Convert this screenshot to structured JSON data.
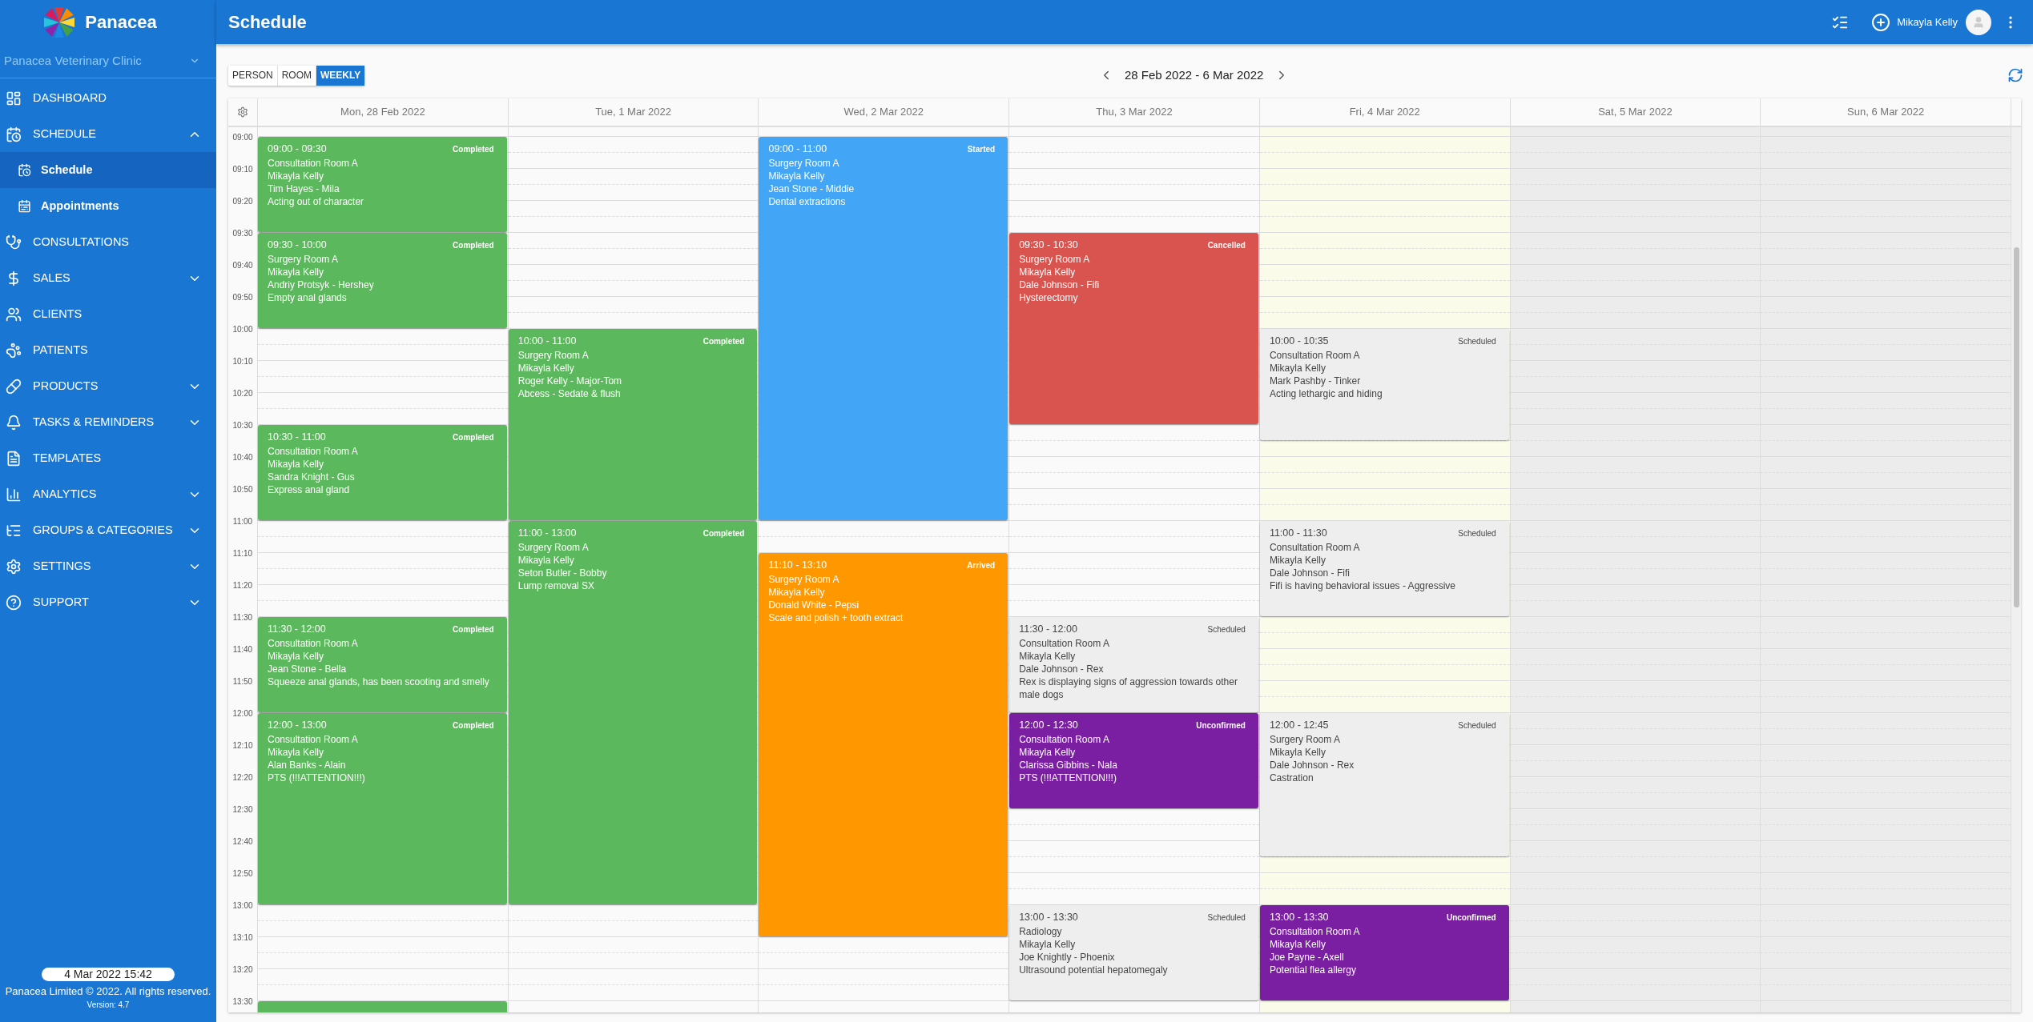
{
  "brand": {
    "name": "Panacea"
  },
  "clinic_select": {
    "value": "Panacea Veterinary Clinic"
  },
  "sidebar": {
    "items": [
      {
        "label": "DASHBOARD",
        "selected": false
      },
      {
        "label": "SCHEDULE",
        "selected": false,
        "expanded": true,
        "children": [
          {
            "label": "Schedule",
            "selected": true
          },
          {
            "label": "Appointments",
            "selected": false
          }
        ]
      },
      {
        "label": "CONSULTATIONS",
        "selected": false
      },
      {
        "label": "SALES",
        "selected": false,
        "expanded": false
      },
      {
        "label": "CLIENTS",
        "selected": false
      },
      {
        "label": "PATIENTS",
        "selected": false
      },
      {
        "label": "PRODUCTS",
        "selected": false,
        "expanded": false
      },
      {
        "label": "TASKS & REMINDERS",
        "selected": false,
        "expanded": false
      },
      {
        "label": "TEMPLATES",
        "selected": false
      },
      {
        "label": "ANALYTICS",
        "selected": false,
        "expanded": false
      },
      {
        "label": "GROUPS & CATEGORIES",
        "selected": false,
        "expanded": false
      },
      {
        "label": "SETTINGS",
        "selected": false,
        "expanded": false
      },
      {
        "label": "SUPPORT",
        "selected": false,
        "expanded": false
      }
    ]
  },
  "footer": {
    "datetime": "4 Mar 2022 15:42",
    "copyright": "Panacea Limited © 2022. All rights reserved.",
    "version": "Version: 4.7"
  },
  "header": {
    "title": "Schedule",
    "user": "Mikayla Kelly"
  },
  "view_tabs": [
    {
      "label": "PERSON",
      "selected": false
    },
    {
      "label": "ROOM",
      "selected": false
    },
    {
      "label": "WEEKLY",
      "selected": true
    }
  ],
  "date_range": "28 Feb 2022 - 6 Mar 2022",
  "time_labels": [
    "09:00",
    "09:10",
    "09:20",
    "09:30",
    "09:40",
    "09:50",
    "10:00",
    "10:10",
    "10:20",
    "10:30",
    "10:40",
    "10:50",
    "11:00",
    "11:10",
    "11:20",
    "11:30",
    "11:40",
    "11:50",
    "12:00",
    "12:10",
    "12:20",
    "12:30",
    "12:40",
    "12:50",
    "13:00",
    "13:10",
    "13:20",
    "13:30"
  ],
  "days": [
    {
      "label": "Mon, 28 Feb 2022",
      "kind": "weekday",
      "events": [
        {
          "time": "09:00 - 09:30",
          "status": "Completed",
          "color": "#5cb85c",
          "lines": [
            "Consultation Room A",
            "Mikayla Kelly",
            "Tim Hayes - Mila",
            "Acting out of character"
          ]
        },
        {
          "time": "09:30 - 10:00",
          "status": "Completed",
          "color": "#5cb85c",
          "lines": [
            "Surgery Room A",
            "Mikayla Kelly",
            "Andriy Protsyk - Hershey",
            "Empty anal glands"
          ]
        },
        {
          "time": "10:30 - 11:00",
          "status": "Completed",
          "color": "#5cb85c",
          "lines": [
            "Consultation Room A",
            "Mikayla Kelly",
            "Sandra Knight - Gus",
            "Express anal gland"
          ]
        },
        {
          "time": "11:30 - 12:00",
          "status": "Completed",
          "color": "#5cb85c",
          "lines": [
            "Consultation Room A",
            "Mikayla Kelly",
            "Jean Stone - Bella",
            "Squeeze anal glands, has been scooting and smelly"
          ]
        },
        {
          "time": "12:00 - 13:00",
          "status": "Completed",
          "color": "#5cb85c",
          "lines": [
            "Consultation Room A",
            "Mikayla Kelly",
            "Alan Banks - Alain",
            "PTS (!!!ATTENTION!!!)"
          ]
        },
        {
          "kind": "cut",
          "color": "#5cb85c"
        }
      ]
    },
    {
      "label": "Tue, 1 Mar 2022",
      "kind": "weekday",
      "events": [
        {
          "time": "10:00 - 11:00",
          "status": "Completed",
          "color": "#5cb85c",
          "lines": [
            "Surgery Room A",
            "Mikayla Kelly",
            "Roger Kelly - Major-Tom",
            "Abcess - Sedate & flush"
          ]
        },
        {
          "time": "11:00 - 13:00",
          "status": "Completed",
          "color": "#5cb85c",
          "lines": [
            "Surgery Room A",
            "Mikayla Kelly",
            "Seton Butler - Bobby",
            "Lump removal SX"
          ]
        }
      ]
    },
    {
      "label": "Wed, 2 Mar 2022",
      "kind": "weekday",
      "events": [
        {
          "time": "09:00 - 11:00",
          "status": "Started",
          "color": "#42a5f5",
          "lines": [
            "Surgery Room A",
            "Mikayla Kelly",
            "Jean Stone - Middie",
            "Dental extractions"
          ]
        },
        {
          "time": "11:10 - 13:10",
          "status": "Arrived",
          "color": "#ff9800",
          "lines": [
            "Surgery Room A",
            "Mikayla Kelly",
            "Donald White - Pepsi",
            "Scale and polish + tooth extract"
          ]
        }
      ]
    },
    {
      "label": "Thu, 3 Mar 2022",
      "kind": "weekday",
      "events": [
        {
          "time": "09:30 - 10:30",
          "status": "Cancelled",
          "color": "#d9534f",
          "lines": [
            "Surgery Room A",
            "Mikayla Kelly",
            "Dale Johnson - Fifi",
            "Hysterectomy"
          ]
        },
        {
          "time": "11:30 - 12:00",
          "status": "Scheduled",
          "color": "#eeeeee",
          "lines": [
            "Consultation Room A",
            "Mikayla Kelly",
            "Dale Johnson - Rex",
            "Rex is displaying signs of aggression towards other male dogs"
          ]
        },
        {
          "time": "12:00 - 12:30",
          "status": "Unconfirmed",
          "color": "#7b1fa2",
          "lines": [
            "Consultation Room A",
            "Mikayla Kelly",
            "Clarissa Gibbins - Nala",
            "PTS (!!!ATTENTION!!!)"
          ]
        },
        {
          "time": "13:00 - 13:30",
          "status": "Scheduled",
          "color": "#eeeeee",
          "lines": [
            "Radiology",
            "Mikayla Kelly",
            "Joe Knightly - Phoenix",
            "Ultrasound potential hepatomegaly"
          ]
        }
      ]
    },
    {
      "label": "Fri, 4 Mar 2022",
      "kind": "today",
      "events": [
        {
          "time": "10:00 - 10:35",
          "status": "Scheduled",
          "color": "#eeeeee",
          "lines": [
            "Consultation Room A",
            "Mikayla Kelly",
            "Mark Pashby - Tinker",
            "Acting lethargic and hiding"
          ]
        },
        {
          "time": "11:00 - 11:30",
          "status": "Scheduled",
          "color": "#eeeeee",
          "lines": [
            "Consultation Room A",
            "Mikayla Kelly",
            "Dale Johnson - Fifi",
            "Fifi is having behavioral issues - Aggressive"
          ]
        },
        {
          "time": "12:00 - 12:45",
          "status": "Scheduled",
          "color": "#eeeeee",
          "lines": [
            "Surgery Room A",
            "Mikayla Kelly",
            "Dale Johnson - Rex",
            "Castration"
          ]
        },
        {
          "time": "13:00 - 13:30",
          "status": "Unconfirmed",
          "color": "#7b1fa2",
          "lines": [
            "Consultation Room A",
            "Mikayla Kelly",
            "Joe Payne - Axell",
            "Potential flea allergy"
          ]
        }
      ]
    },
    {
      "label": "Sat, 5 Mar 2022",
      "kind": "weekend"
    },
    {
      "label": "Sun, 6 Mar 2022",
      "kind": "weekend"
    }
  ]
}
